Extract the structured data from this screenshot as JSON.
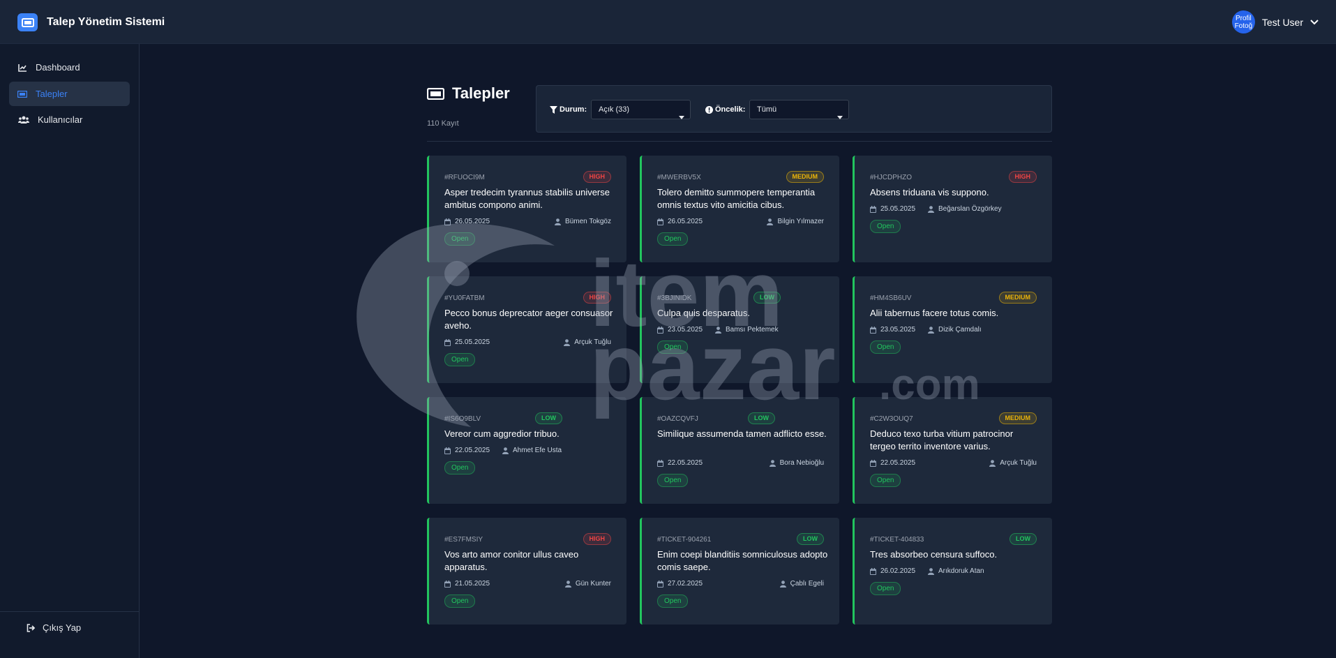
{
  "app": {
    "title": "Talep Yönetim Sistemi",
    "icon": "ticket-icon"
  },
  "user": {
    "avatar_text_line1": "Profil",
    "avatar_text_line2": "Fotoğ",
    "name": "Test User"
  },
  "sidebar": {
    "items": [
      {
        "label": "Dashboard",
        "icon": "chart-line-icon",
        "active": false
      },
      {
        "label": "Talepler",
        "icon": "ticket-icon",
        "active": true
      },
      {
        "label": "Kullanıcılar",
        "icon": "users-icon",
        "active": false
      }
    ],
    "logout_label": "Çıkış Yap"
  },
  "page": {
    "title": "Talepler",
    "record_count": "110 Kayıt"
  },
  "filters": {
    "status_label": "Durum:",
    "status_value": "Açık (33)",
    "priority_label": "Öncelik:",
    "priority_value": "Tümü"
  },
  "colors": {
    "accent": "#3b82f6",
    "open": "#22c55e",
    "high": "#ef4444",
    "medium": "#eab308",
    "low": "#22c55e"
  },
  "tickets": [
    {
      "id": "#RFUOCI9M",
      "priority": "HIGH",
      "title": "Asper tredecim tyrannus stabilis universe ambitus compono animi.",
      "date": "26.05.2025",
      "assignee": "Bümen Tokgöz",
      "status": "Open"
    },
    {
      "id": "#MWERBV5X",
      "priority": "MEDIUM",
      "title": "Tolero demitto summopere temperantia omnis textus vito amicitia cibus.",
      "date": "26.05.2025",
      "assignee": "Bilgin Yılmazer",
      "status": "Open"
    },
    {
      "id": "#HJCDPHZO",
      "priority": "HIGH",
      "title": "Absens triduana vis suppono.",
      "date": "25.05.2025",
      "assignee": "Beğarslan Özgörkey",
      "status": "Open"
    },
    {
      "id": "#YU0FATBM",
      "priority": "HIGH",
      "title": "Pecco bonus deprecator aeger consuasor aveho.",
      "date": "25.05.2025",
      "assignee": "Arçuk Tuğlu",
      "status": "Open"
    },
    {
      "id": "#3BJINIDK",
      "priority": "LOW",
      "title": "Culpa quis desparatus.",
      "date": "23.05.2025",
      "assignee": "Bamsı Pektemek",
      "status": "Open"
    },
    {
      "id": "#HM4SB6UV",
      "priority": "MEDIUM",
      "title": "Alii tabernus facere totus comis.",
      "date": "23.05.2025",
      "assignee": "Dizik Çamdalı",
      "status": "Open"
    },
    {
      "id": "#IS6O9BLV",
      "priority": "LOW",
      "title": "Vereor cum aggredior tribuo.",
      "date": "22.05.2025",
      "assignee": "Ahmet Efe Usta",
      "status": "Open"
    },
    {
      "id": "#OAZCQVFJ",
      "priority": "LOW",
      "title": "Similique assumenda tamen adflicto esse.",
      "date": "22.05.2025",
      "assignee": "Bora Nebioğlu",
      "status": "Open"
    },
    {
      "id": "#C2W3OUQ7",
      "priority": "MEDIUM",
      "title": "Deduco texo turba vitium patrocinor tergeo territo inventore varius.",
      "date": "22.05.2025",
      "assignee": "Arçuk Tuğlu",
      "status": "Open"
    },
    {
      "id": "#ES7FMSIY",
      "priority": "HIGH",
      "title": "Vos arto amor conitor ullus caveo apparatus.",
      "date": "21.05.2025",
      "assignee": "Gün Kunter",
      "status": "Open"
    },
    {
      "id": "#TICKET-904261",
      "priority": "LOW",
      "title": "Enim coepi blanditiis somniculosus adopto comis saepe.",
      "date": "27.02.2025",
      "assignee": "Çablı Egeli",
      "status": "Open"
    },
    {
      "id": "#TICKET-404833",
      "priority": "LOW",
      "title": "Tres absorbeo censura suffoco.",
      "date": "26.02.2025",
      "assignee": "Arıkdoruk Atan",
      "status": "Open"
    }
  ],
  "watermark": {
    "text_line1": "item",
    "text_line2": "pazar",
    "suffix": ".com"
  }
}
